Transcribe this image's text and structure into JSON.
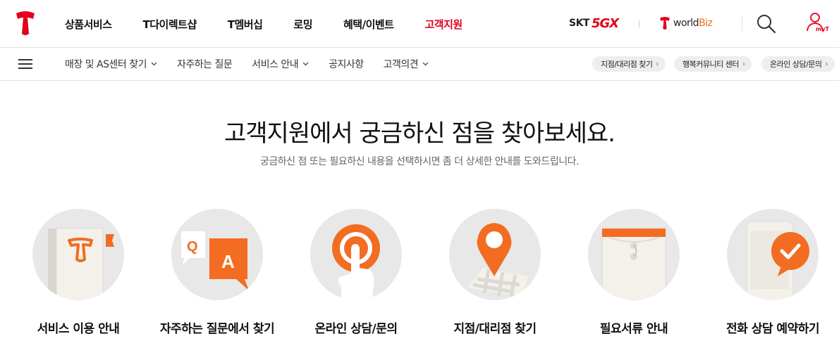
{
  "gnb": {
    "menu": [
      "상품서비스",
      "T다이렉트샵",
      "T멤버십",
      "로밍",
      "혜택/이벤트",
      "고객지원"
    ],
    "active_index": 5,
    "skt_label": "SKT",
    "fivegx_label": "5GX",
    "worldbiz_label": "world",
    "worldbiz_suffix": "Biz",
    "myt_label": "myT",
    "brand_color": "#e4001b",
    "accent_color": "#f26d21"
  },
  "lnb": {
    "items": [
      {
        "label": "매장 및 AS센터 찾기",
        "dropdown": true
      },
      {
        "label": "자주하는 질문",
        "dropdown": false
      },
      {
        "label": "서비스 안내",
        "dropdown": true
      },
      {
        "label": "공지사항",
        "dropdown": false
      },
      {
        "label": "고객의견",
        "dropdown": true
      }
    ],
    "quick_links": [
      "지점/대리점 찾기",
      "행복커뮤니티 센터",
      "온라인 상담/문의"
    ]
  },
  "main": {
    "title": "고객지원에서 궁금하신 점을 찾아보세요.",
    "subtitle": "궁금하신 점 또는 필요하신 내용을 선택하시면 좀 더 상세한 안내를 도와드립니다.",
    "cards": [
      {
        "label": "서비스 이용 안내",
        "icon": "service-guide-book-icon"
      },
      {
        "label": "자주하는 질문에서 찾기",
        "icon": "qa-icon"
      },
      {
        "label": "온라인 상담/문의",
        "icon": "online-consult-touch-icon"
      },
      {
        "label": "지점/대리점 찾기",
        "icon": "map-pin-icon"
      },
      {
        "label": "필요서류 안내",
        "icon": "document-envelope-icon"
      },
      {
        "label": "전화 상담 예약하기",
        "icon": "phone-reservation-check-icon"
      }
    ]
  }
}
